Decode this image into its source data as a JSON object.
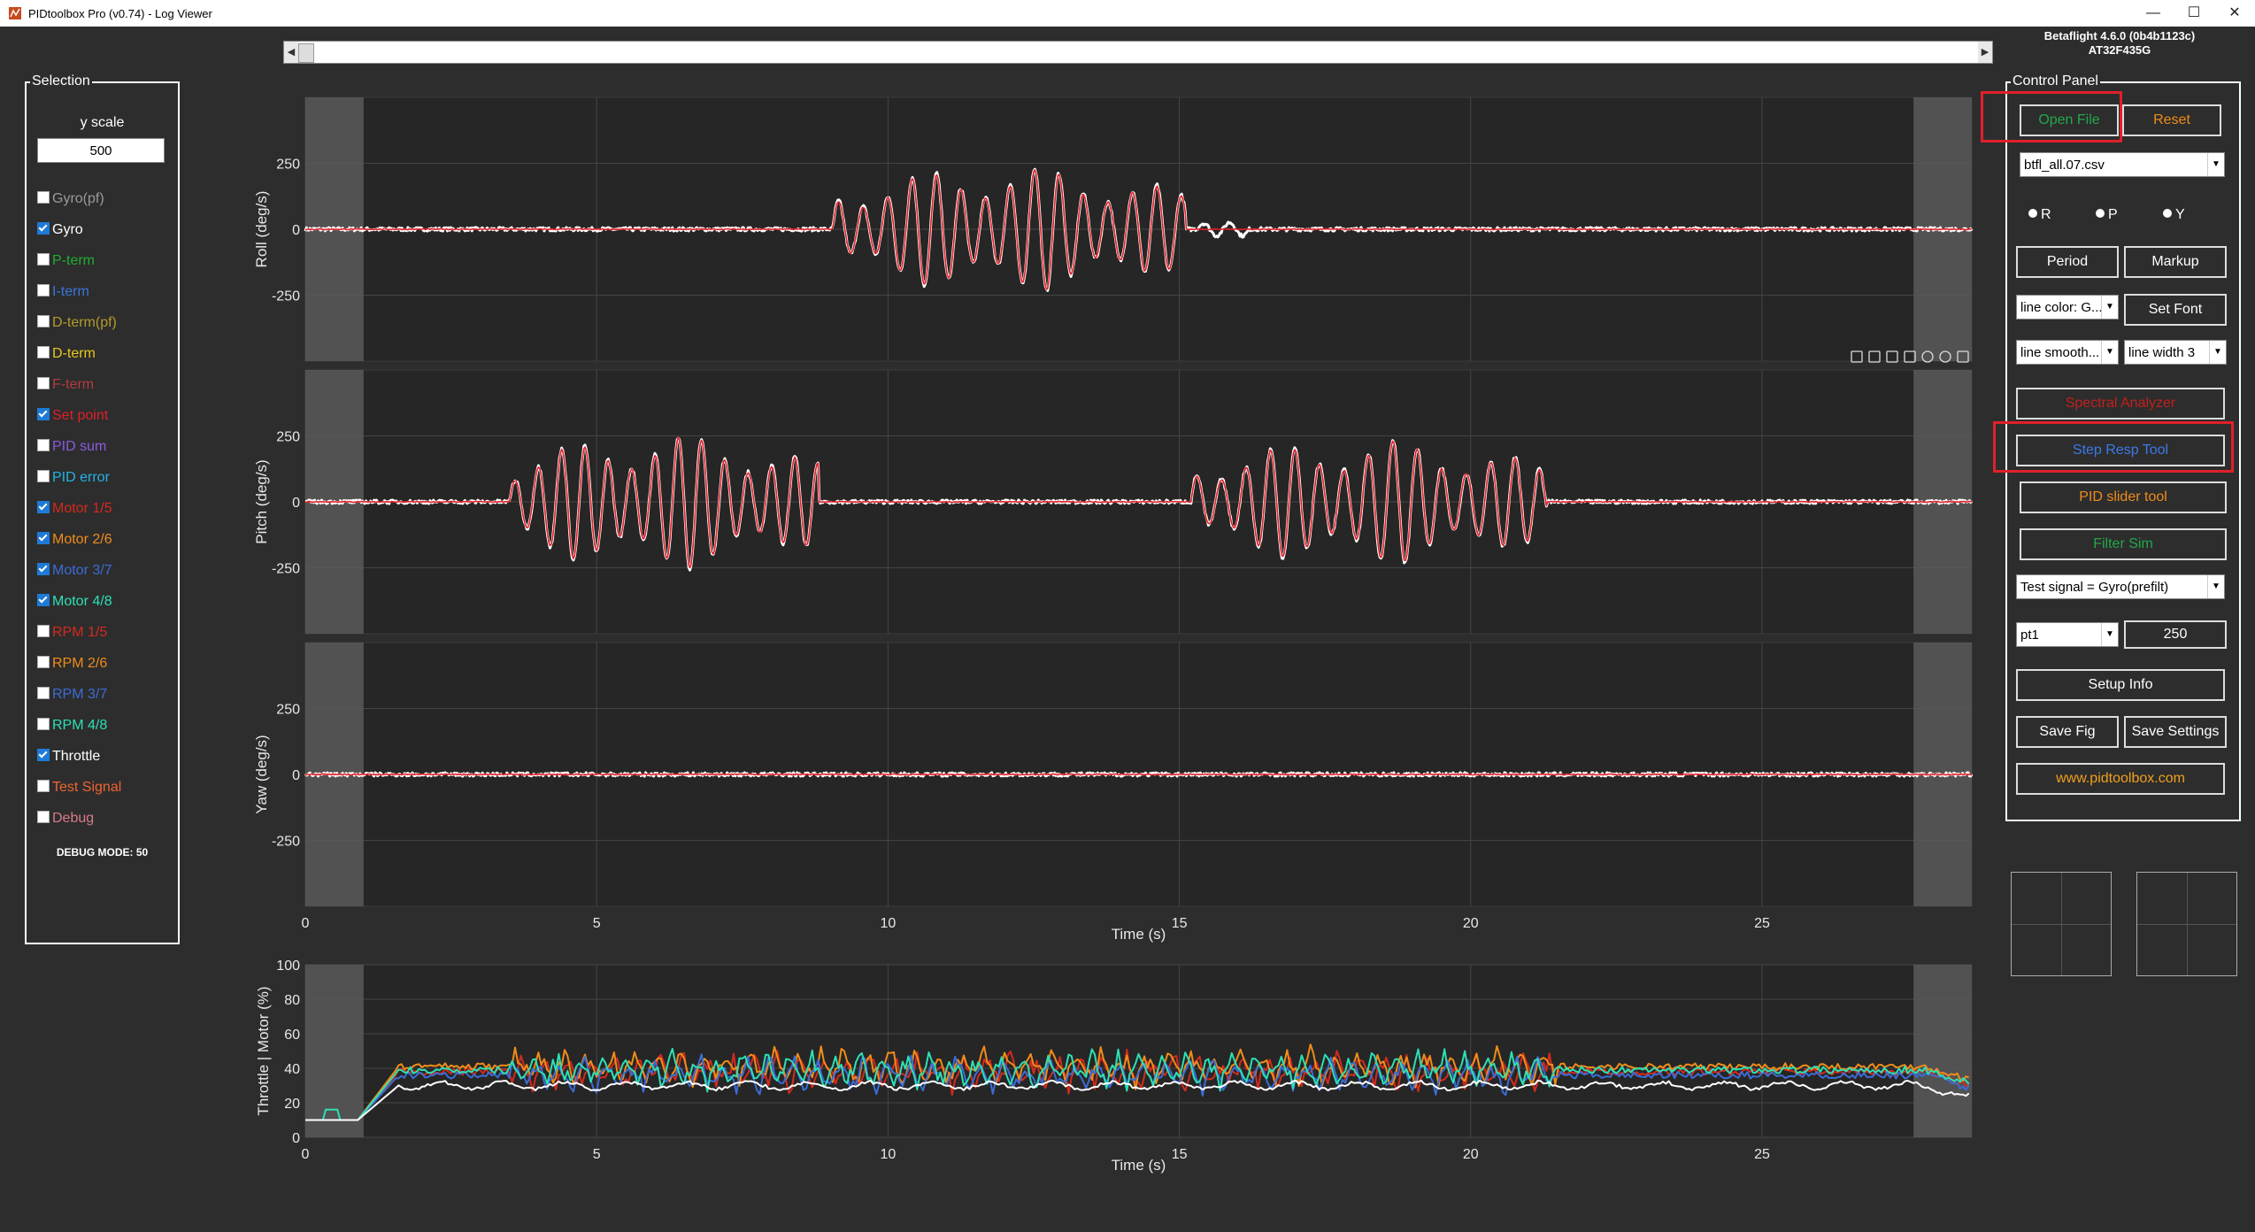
{
  "window": {
    "title": "PIDtoolbox Pro (v0.74) - Log Viewer",
    "minimize": "—",
    "maximize": "☐",
    "close": "✕"
  },
  "firmware": {
    "line1": "Betaflight 4.6.0 (0b4b1123c)",
    "line2": "AT32F435G"
  },
  "selection": {
    "title": "Selection",
    "yscale_label": "y scale",
    "yscale_value": "500",
    "items": [
      {
        "label": "Gyro(pf)",
        "checked": false,
        "color": "#9a9a9a"
      },
      {
        "label": "Gyro",
        "checked": true,
        "color": "#ffffff"
      },
      {
        "label": "P-term",
        "checked": false,
        "color": "#1fae2f"
      },
      {
        "label": "I-term",
        "checked": false,
        "color": "#3a74e0"
      },
      {
        "label": "D-term(pf)",
        "checked": false,
        "color": "#b49a2a"
      },
      {
        "label": "D-term",
        "checked": false,
        "color": "#e8c81e"
      },
      {
        "label": "F-term",
        "checked": false,
        "color": "#b43c3c"
      },
      {
        "label": "Set point",
        "checked": true,
        "color": "#e0202a"
      },
      {
        "label": "PID sum",
        "checked": false,
        "color": "#8a5ae0"
      },
      {
        "label": "PID error",
        "checked": false,
        "color": "#22b4e6"
      },
      {
        "label": "Motor 1/5",
        "checked": true,
        "color": "#d42a1e"
      },
      {
        "label": "Motor 2/6",
        "checked": true,
        "color": "#f08c1a"
      },
      {
        "label": "Motor 3/7",
        "checked": true,
        "color": "#3b6cd6"
      },
      {
        "label": "Motor 4/8",
        "checked": true,
        "color": "#2de0b4"
      },
      {
        "label": "RPM 1/5",
        "checked": false,
        "color": "#d42a1e"
      },
      {
        "label": "RPM 2/6",
        "checked": false,
        "color": "#f08c1a"
      },
      {
        "label": "RPM 3/7",
        "checked": false,
        "color": "#3b6cd6"
      },
      {
        "label": "RPM 4/8",
        "checked": false,
        "color": "#2de0b4"
      },
      {
        "label": "Throttle",
        "checked": true,
        "color": "#ffffff"
      },
      {
        "label": "Test Signal",
        "checked": false,
        "color": "#f06432"
      },
      {
        "label": "Debug",
        "checked": false,
        "color": "#d87a8a"
      }
    ],
    "debug_mode": "DEBUG MODE: 50"
  },
  "control": {
    "title": "Control Panel",
    "open_file": "Open File",
    "reset": "Reset",
    "file": "btfl_all.07.csv",
    "radios": [
      "R",
      "P",
      "Y"
    ],
    "period": "Period",
    "markup": "Markup",
    "line_color": "line color: G...",
    "set_font": "Set Font",
    "line_smooth": "line smooth...",
    "line_width": "line width 3",
    "spectral": "Spectral Analyzer",
    "step_resp": "Step Resp Tool",
    "pid_slider": "PID slider tool",
    "filter_sim": "Filter Sim",
    "test_signal": "Test signal = Gyro(prefilt)",
    "filter_type": "pt1",
    "filter_value": "250",
    "setup_info": "Setup Info",
    "save_fig": "Save Fig",
    "save_settings": "Save Settings",
    "website": "www.pidtoolbox.com",
    "colors": {
      "open": "#22a84a",
      "reset": "#f08c1a",
      "spectral": "#c0201e",
      "step": "#3b7ae8",
      "pid": "#f08c1a",
      "filter": "#22a84a",
      "web": "#f0a01e",
      "highlight": "#e0202a"
    }
  },
  "chart_data": [
    {
      "type": "line",
      "title": "",
      "xlabel": "",
      "ylabel": "Roll (deg/s)",
      "xlim": [
        0,
        28.6
      ],
      "ylim": [
        -500,
        500
      ],
      "yticks": [
        250,
        0,
        -250
      ],
      "xticks": [
        0,
        5,
        10,
        15,
        20,
        25
      ],
      "series": [
        {
          "name": "Gyro",
          "color": "#ffffff",
          "bursts": [
            {
              "t0": 9.05,
              "t1": 15.1,
              "amp": 240,
              "period": 0.42
            },
            {
              "t0": 15.3,
              "t1": 16.2,
              "amp": 50,
              "period": 0.45
            }
          ]
        },
        {
          "name": "Set point",
          "color": "#e0202a",
          "bursts": [
            {
              "t0": 9.05,
              "t1": 15.1,
              "amp": 235,
              "period": 0.42
            }
          ]
        }
      ]
    },
    {
      "type": "line",
      "title": "",
      "xlabel": "",
      "ylabel": "Pitch (deg/s)",
      "xlim": [
        0,
        28.6
      ],
      "ylim": [
        -500,
        500
      ],
      "yticks": [
        250,
        0,
        -250
      ],
      "xticks": [
        0,
        5,
        10,
        15,
        20,
        25
      ],
      "series": [
        {
          "name": "Gyro",
          "color": "#ffffff",
          "bursts": [
            {
              "t0": 3.5,
              "t1": 8.8,
              "amp": 260,
              "period": 0.4
            },
            {
              "t0": 15.2,
              "t1": 21.3,
              "amp": 240,
              "period": 0.42
            }
          ]
        },
        {
          "name": "Set point",
          "color": "#e0202a",
          "bursts": [
            {
              "t0": 3.5,
              "t1": 8.8,
              "amp": 255,
              "period": 0.4
            },
            {
              "t0": 15.2,
              "t1": 21.3,
              "amp": 235,
              "period": 0.42
            }
          ]
        }
      ]
    },
    {
      "type": "line",
      "title": "",
      "xlabel": "Time (s)",
      "ylabel": "Yaw (deg/s)",
      "xlim": [
        0,
        28.6
      ],
      "ylim": [
        -500,
        500
      ],
      "yticks": [
        250,
        0,
        -250
      ],
      "xticks": [
        0,
        5,
        10,
        15,
        20,
        25
      ],
      "series": [
        {
          "name": "Gyro",
          "color": "#ffffff",
          "bursts": []
        },
        {
          "name": "Set point",
          "color": "#e0202a",
          "bursts": []
        }
      ]
    },
    {
      "type": "line",
      "title": "",
      "xlabel": "Time (s)",
      "ylabel": "Throttle | Motor (%)",
      "xlim": [
        0,
        28.6
      ],
      "ylim": [
        0,
        100
      ],
      "yticks": [
        100,
        80,
        60,
        40,
        20,
        0
      ],
      "xticks": [
        0,
        5,
        10,
        15,
        20,
        25
      ],
      "series": [
        {
          "name": "Motor 1/5",
          "color": "#d42a1e",
          "base": 38
        },
        {
          "name": "Motor 2/6",
          "color": "#f08c1a",
          "base": 41
        },
        {
          "name": "Motor 3/7",
          "color": "#3b6cd6",
          "base": 36
        },
        {
          "name": "Motor 4/8",
          "color": "#2de0b4",
          "base": 39
        },
        {
          "name": "Throttle",
          "color": "#ffffff",
          "base": 30
        }
      ]
    }
  ]
}
